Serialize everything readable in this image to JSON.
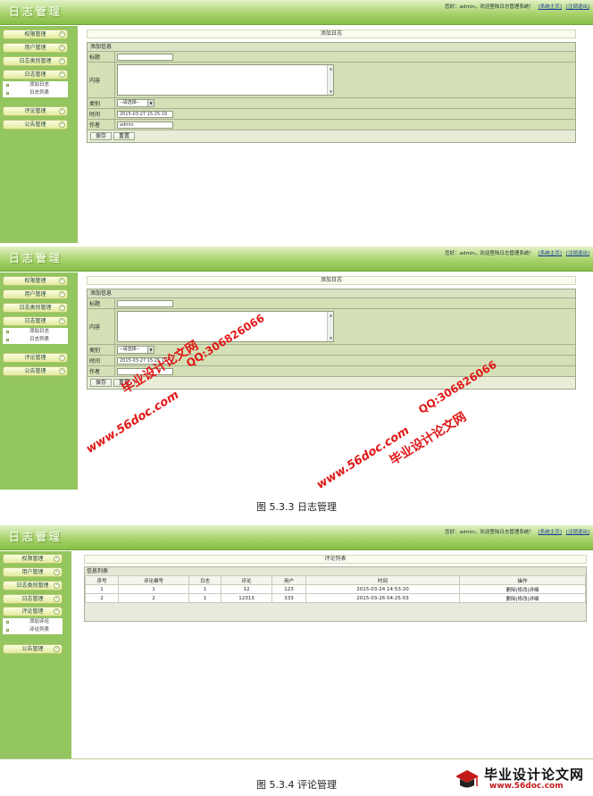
{
  "app": {
    "logo_text": "日志管理",
    "greeting": "您好：admin，欢迎登陆日志管理系统！",
    "home_link": "[系统主页]",
    "logout_link": "[注销退出]"
  },
  "menu": {
    "items": [
      "权限管理",
      "用户管理",
      "日志类别管理",
      "日志管理",
      "评论管理",
      "公告管理"
    ],
    "log_sub": [
      "添加日志",
      "日志列表"
    ],
    "comment_sub": [
      "添加评论",
      "评论列表"
    ],
    "arrow_glyph": "»"
  },
  "add_log": {
    "panel_title": "添加日志",
    "form_title": "添加信息",
    "labels": {
      "title": "标题",
      "content": "内容",
      "category": "类别",
      "time": "时间",
      "author": "作者"
    },
    "category_value": "--请选择--",
    "time_value": "2015-03-27 15:25:19",
    "author_value": "admin",
    "save_label": "保存",
    "reset_label": "重置"
  },
  "comment_list": {
    "panel_title": "评论列表",
    "table_title": "信息列表",
    "columns": [
      "序号",
      "评论编号",
      "日志",
      "评论",
      "用户",
      "时间",
      "操作"
    ],
    "rows": [
      [
        "1",
        "1",
        "1",
        "12",
        "123",
        "2015-03-24 14:53:20",
        "删除|修改|详细"
      ],
      [
        "2",
        "2",
        "1",
        "12313",
        "333",
        "2015-03-26 04:25:03",
        "删除|修改|详细"
      ]
    ]
  },
  "captions": {
    "fig1": "图 5.3.3 日志管理",
    "fig2": "图 5.3.4 评论管理"
  },
  "watermarks": {
    "site": "www.56doc.com",
    "name": "毕业设计论文网",
    "qq": "QQ:306826066"
  },
  "corner_logo": {
    "title": "毕业设计论文网",
    "url": "www.56doc.com"
  },
  "colors": {
    "header_green": "#86bf46",
    "sidebar_green": "#93c560",
    "form_green": "#d4e0b5",
    "watermark_red": "#e01818"
  }
}
